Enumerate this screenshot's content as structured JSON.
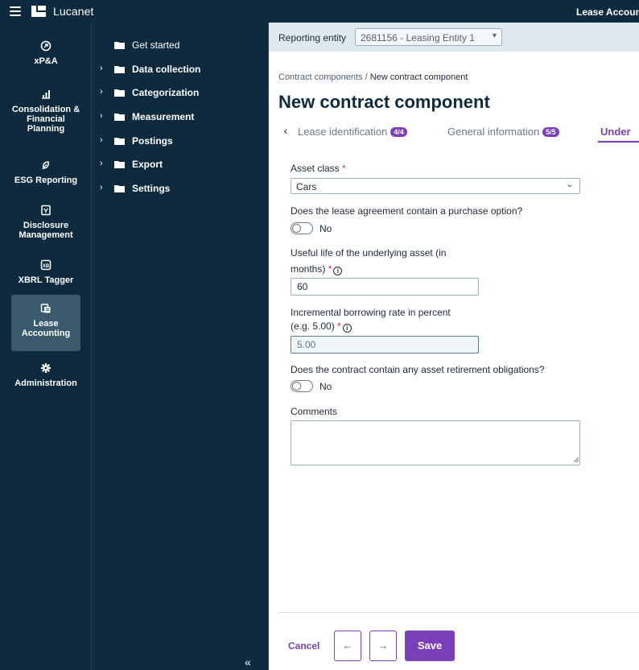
{
  "app": {
    "brand": "Lucanet",
    "top_right_title": "Lease Accoun"
  },
  "colors": {
    "navy": "#0e2a3e",
    "accent": "#7a3fb8",
    "entity_bar": "#dde9ef",
    "required": "#d0312d"
  },
  "rail": {
    "items": [
      {
        "label": "xP&A",
        "icon": "xpa-icon"
      },
      {
        "label": "Consolidation & Financial Planning",
        "icon": "chart-icon"
      },
      {
        "label": "ESG Reporting",
        "icon": "leaf-icon"
      },
      {
        "label": "Disclosure Management",
        "icon": "document-icon"
      },
      {
        "label": "XBRL Tagger",
        "icon": "xbrl-icon"
      },
      {
        "label": "Lease Accounting",
        "icon": "lease-icon",
        "active": true
      },
      {
        "label": "Administration",
        "icon": "gear-icon"
      }
    ]
  },
  "tree": {
    "items": [
      {
        "label": "Get started",
        "expandable": false
      },
      {
        "label": "Data collection",
        "expandable": true
      },
      {
        "label": "Categorization",
        "expandable": true
      },
      {
        "label": "Measurement",
        "expandable": true
      },
      {
        "label": "Postings",
        "expandable": true
      },
      {
        "label": "Export",
        "expandable": true
      },
      {
        "label": "Settings",
        "expandable": true
      }
    ],
    "collapse_glyph": "«"
  },
  "entity": {
    "label": "Reporting entity",
    "value": "2681156 - Leasing Entity 1"
  },
  "breadcrumb": {
    "parent": "Contract components",
    "separator": " / ",
    "current": "New contract component"
  },
  "page_title": "New contract component",
  "tabs": [
    {
      "label": "Lease identification",
      "badge": "4/4"
    },
    {
      "label": "General information",
      "badge": "5/5"
    },
    {
      "label": "Under",
      "active": true
    }
  ],
  "form": {
    "asset_class": {
      "label": "Asset class",
      "required_mark": "*",
      "value": "Cars"
    },
    "purchase_option": {
      "label": "Does the lease agreement contain a purchase option?",
      "state": "No"
    },
    "useful_life": {
      "label_line1": "Useful life of the underlying asset (in",
      "label_line2": "months)",
      "required_mark": "*",
      "value": "60"
    },
    "borrowing_rate": {
      "label_line1": "Incremental borrowing rate in percent",
      "label_line2": "(e.g. 5.00)",
      "required_mark": "*",
      "value": "5.00"
    },
    "retirement": {
      "label": "Does the contract contain any asset retirement obligations?",
      "state": "No"
    },
    "comments": {
      "label": "Comments",
      "value": ""
    },
    "info_glyph": "i"
  },
  "footer": {
    "cancel": "Cancel",
    "prev": "←",
    "next": "→",
    "save": "Save"
  }
}
